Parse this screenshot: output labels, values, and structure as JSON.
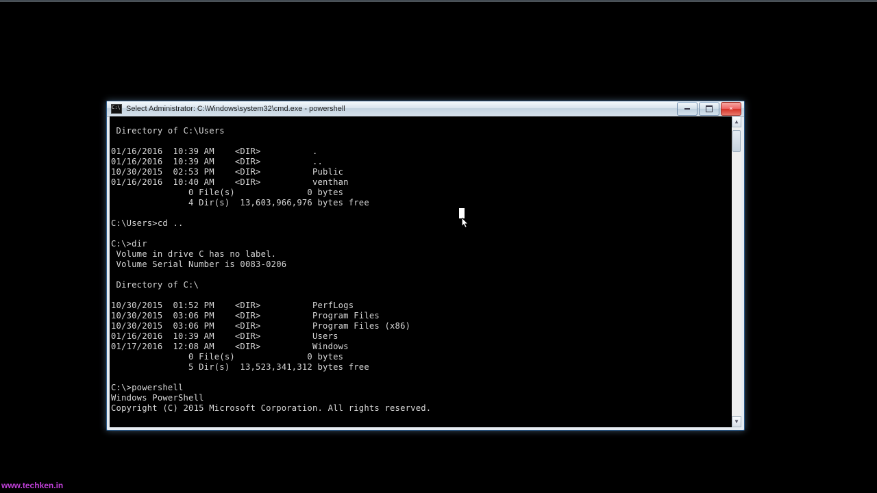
{
  "page": {
    "watermark": "www.techken.in"
  },
  "window": {
    "title": "Select Administrator: C:\\Windows\\system32\\cmd.exe - powershell"
  },
  "terminal": {
    "lines": [
      " Directory of C:\\Users",
      "",
      "01/16/2016  10:39 AM    <DIR>          .",
      "01/16/2016  10:39 AM    <DIR>          ..",
      "10/30/2015  02:53 PM    <DIR>          Public",
      "01/16/2016  10:40 AM    <DIR>          venthan",
      "               0 File(s)              0 bytes",
      "               4 Dir(s)  13,603,966,976 bytes free",
      "",
      "C:\\Users>cd ..",
      "",
      "C:\\>dir",
      " Volume in drive C has no label.",
      " Volume Serial Number is 0083-0206",
      "",
      " Directory of C:\\",
      "",
      "10/30/2015  01:52 PM    <DIR>          PerfLogs",
      "10/30/2015  03:06 PM    <DIR>          Program Files",
      "10/30/2015  03:06 PM    <DIR>          Program Files (x86)",
      "01/16/2016  10:39 AM    <DIR>          Users",
      "01/17/2016  12:08 AM    <DIR>          Windows",
      "               0 File(s)              0 bytes",
      "               5 Dir(s)  13,523,341,312 bytes free",
      "",
      "C:\\>powershell",
      "Windows PowerShell",
      "Copyright (C) 2015 Microsoft Corporation. All rights reserved.",
      ""
    ]
  }
}
